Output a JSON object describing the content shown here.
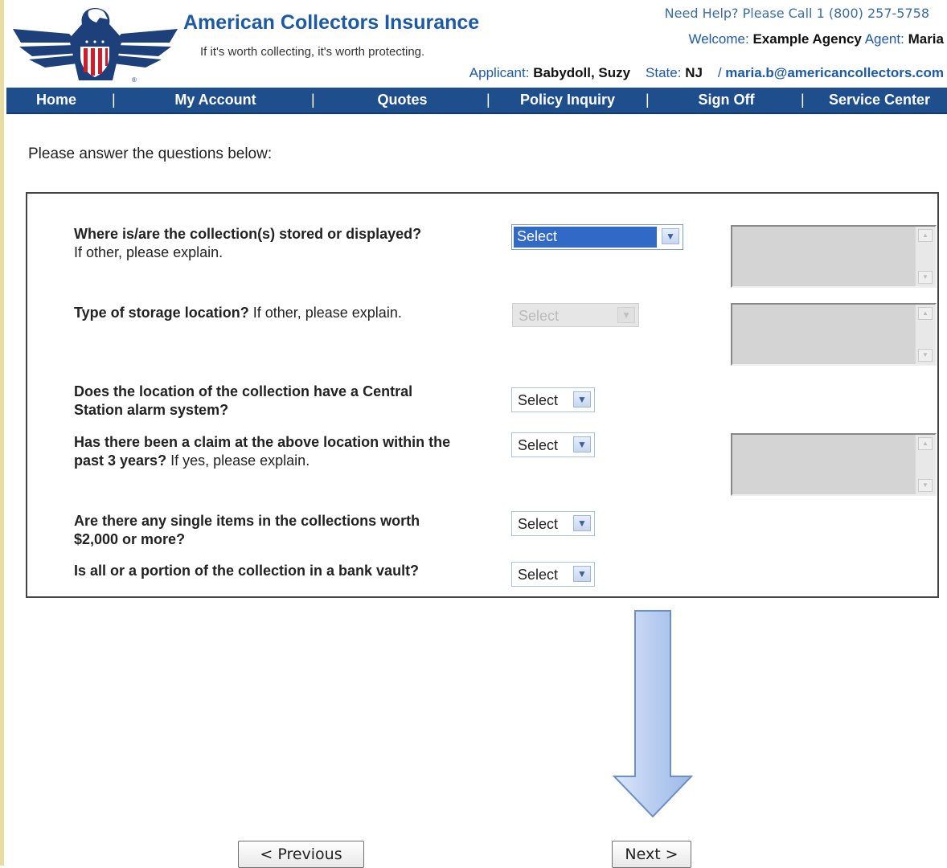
{
  "header": {
    "brand": "American Collectors Insurance",
    "tagline": "If it's worth collecting, it's worth protecting.",
    "help": "Need Help? Please Call 1 (800) 257-5758",
    "welcome_label": "Welcome:",
    "agency": "Example Agency",
    "agent_label": "Agent:",
    "agent": "Maria",
    "applicant_label": "Applicant:",
    "applicant": "Babydoll, Suzy",
    "state_label": "State:",
    "state": "NJ",
    "email_prefix": "/",
    "email": "maria.b@americancollectors.com"
  },
  "nav": {
    "items": [
      "Home",
      "My Account",
      "Quotes",
      "Policy Inquiry",
      "Sign Off",
      "Service Center"
    ],
    "separator": "|"
  },
  "intro": "Please answer the questions below:",
  "questions": [
    {
      "bold": "Where is/are the collection(s) stored or displayed?",
      "normal": "If other, please explain.",
      "select": "Select"
    },
    {
      "bold": "Type of storage location?",
      "normal": "If other, please explain.",
      "select": "Select"
    },
    {
      "bold": "Does the location of the collection have a Central Station alarm system?",
      "normal": "",
      "select": "Select"
    },
    {
      "bold": "Has there been a claim at the above location within the past 3 years?",
      "normal": "If yes, please explain.",
      "select": "Select"
    },
    {
      "bold": "Are there any single items in the collections worth $2,000 or more?",
      "normal": "",
      "select": "Select"
    },
    {
      "bold": "Is all or a portion of the collection in a bank vault?",
      "normal": "",
      "select": "Select"
    }
  ],
  "buttons": {
    "previous": "< Previous",
    "next": "Next >"
  },
  "colors": {
    "nav_bg": "#1f4e8c",
    "brand": "#1d5aa6",
    "highlight": "#3169c6",
    "arrow_fill": "#b8cdf0"
  }
}
